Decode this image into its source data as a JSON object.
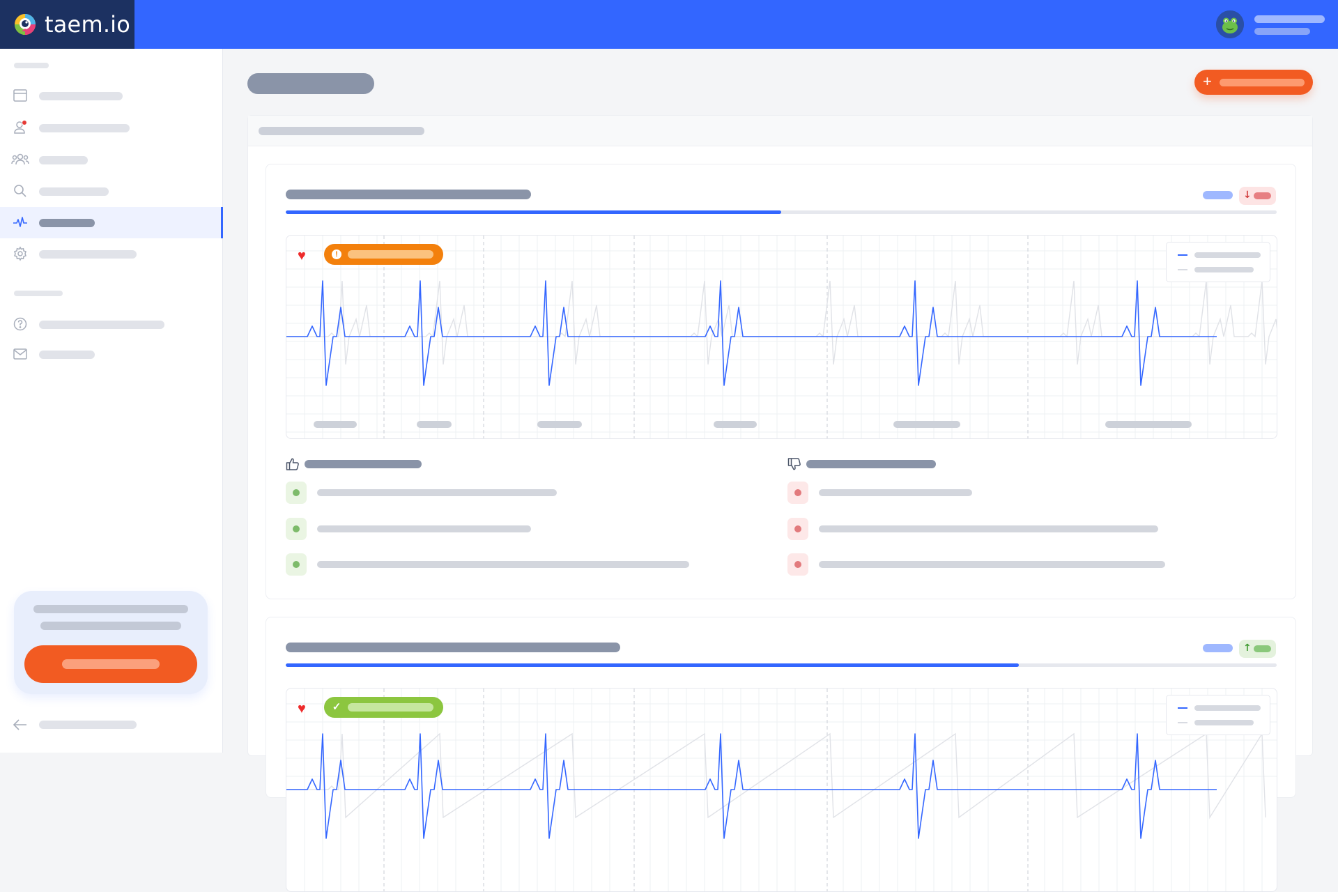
{
  "app": {
    "name": "taem.io",
    "accent": "#3366ff",
    "brand_bg": "#1c3161",
    "cta_color": "#f25b22"
  },
  "header": {
    "avatar_icon": "frog-avatar-icon"
  },
  "sidebar": {
    "items": [
      {
        "icon": "calendar-icon",
        "active": false
      },
      {
        "icon": "user-notification-icon",
        "active": false,
        "badge_color": "#e53935"
      },
      {
        "icon": "team-icon",
        "active": false
      },
      {
        "icon": "search-icon",
        "active": false
      },
      {
        "icon": "heartbeat-icon",
        "active": true
      },
      {
        "icon": "gear-icon",
        "active": false
      },
      {
        "icon": "help-icon",
        "active": false
      },
      {
        "icon": "mail-icon",
        "active": false
      }
    ],
    "collapse_icon": "arrow-left-icon"
  },
  "main": {
    "add_button_icon": "plus-icon",
    "cards": [
      {
        "progress": 0.5,
        "trend": "down",
        "status": "warning",
        "pros_count": 3,
        "cons_count": 3
      },
      {
        "progress": 0.74,
        "trend": "up",
        "status": "ok"
      }
    ]
  }
}
